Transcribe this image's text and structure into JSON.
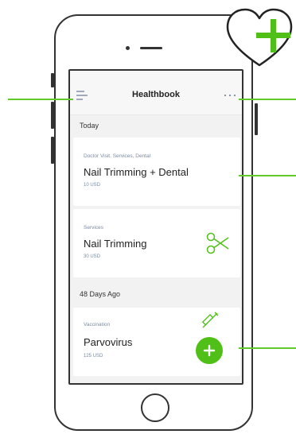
{
  "app": {
    "title": "Healthbook"
  },
  "sections": [
    {
      "label": "Today"
    },
    {
      "label": "48 Days Ago"
    }
  ],
  "entries": [
    {
      "category": "Doctor Visit, Services, Dental",
      "title": "Nail Trimming + Dental",
      "price": "10 USD"
    },
    {
      "category": "Services",
      "title": "Nail Trimming",
      "price": "30 USD",
      "icon": "scissors-icon"
    },
    {
      "category": "Vaccination",
      "title": "Parvovirus",
      "price": "125 USD",
      "icon": "syringe-icon"
    }
  ],
  "icons": {
    "menu": "menu-icon",
    "more": "more-options-icon",
    "add": "plus-icon",
    "badge": "heart-plus-icon"
  },
  "colors": {
    "accent": "#50c018",
    "outline": "#333333",
    "screen_bg": "#f2f2f2",
    "muted_text": "#7a8aa0"
  }
}
